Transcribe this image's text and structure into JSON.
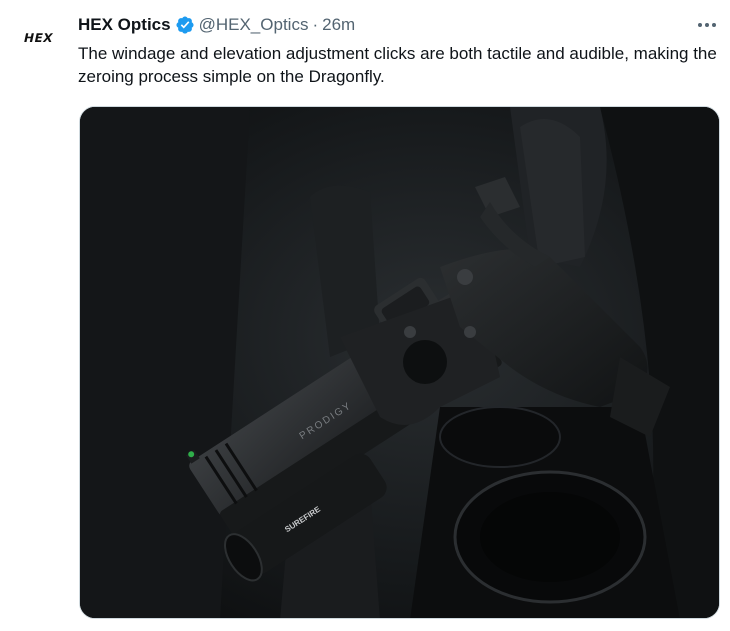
{
  "tweet": {
    "avatar_text": "HEX",
    "author_name": "HEX Optics",
    "handle": "@HEX_Optics",
    "separator": "·",
    "time": "26m",
    "text": "The windage and elevation adjustment clicks are both tactile and audible, making the zeroing process simple on the Dragonfly."
  },
  "media": {
    "slide_text": "PRODIGY",
    "light_text": "SUREFIRE"
  },
  "colors": {
    "verified": "#1d9bf0",
    "secondary_text": "#536471",
    "primary_text": "#0f1419",
    "border": "#cfd9de"
  },
  "icons": {
    "verified": "verified-badge-icon",
    "more": "more-options-icon"
  }
}
